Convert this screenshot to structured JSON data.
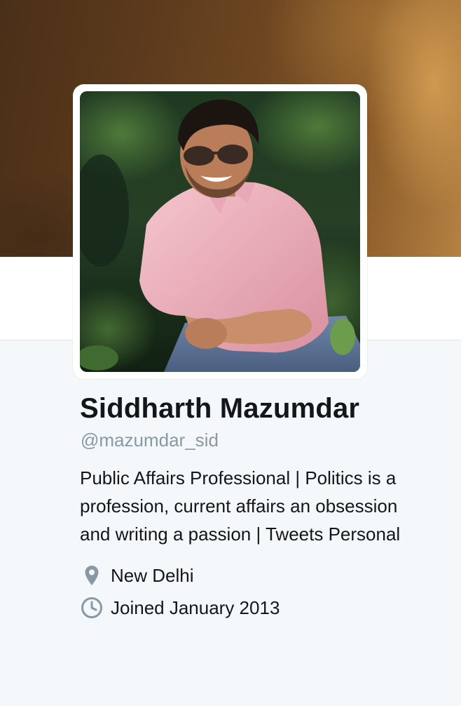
{
  "profile": {
    "name": "Siddharth Mazumdar",
    "screen_name": "@mazumdar_sid",
    "bio_lines": [
      "Public Affairs Professional | Politics is a",
      "profession, current affairs an obsession",
      "and writing a passion | Tweets Personal"
    ],
    "location": "New Delhi",
    "joined": "Joined January 2013"
  },
  "icons": {
    "location": "map-pin-icon",
    "joined": "clock-icon"
  },
  "colors": {
    "background": "#f5f8fa",
    "text": "#14171a",
    "secondary_text": "#8899a6",
    "icon": "#8899a6",
    "avatar_border": "#ffffff"
  }
}
